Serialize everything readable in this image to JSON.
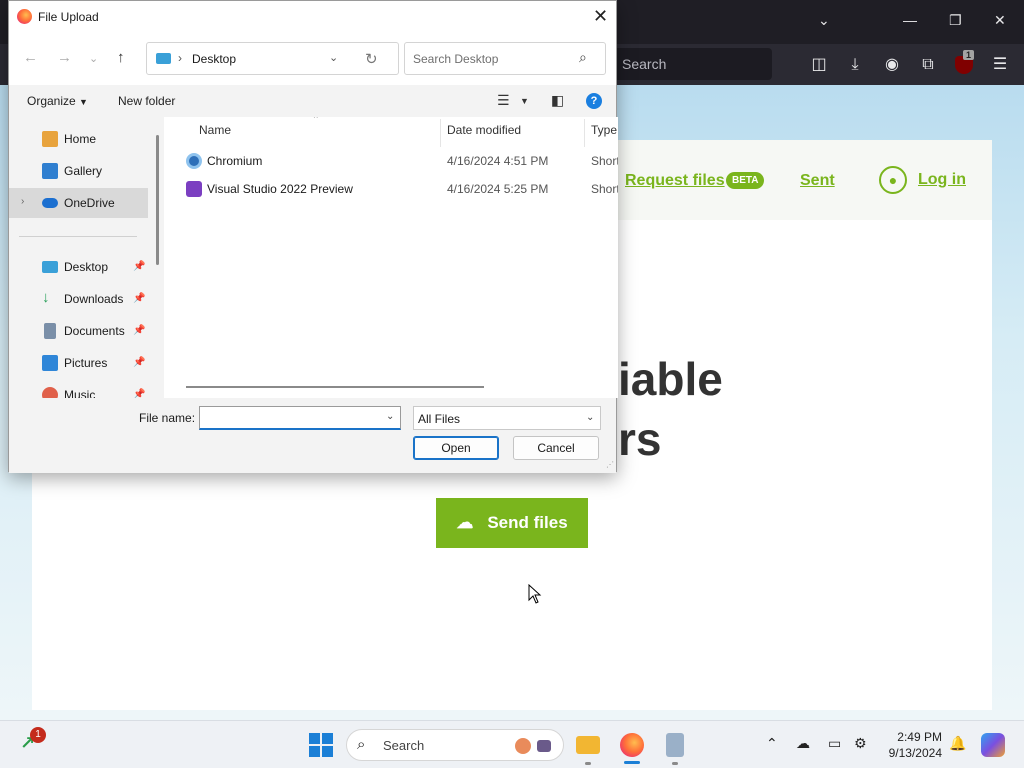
{
  "browser": {
    "search_placeholder": "Search",
    "window_controls": {
      "chevron": "⌄",
      "minimize": "—",
      "restore": "❐",
      "close": "✕"
    },
    "toolbar_icons": [
      "pocket-icon",
      "download-icon",
      "account-icon",
      "extensions-icon",
      "ublock-icon",
      "menu-icon"
    ],
    "ublock_badge": "1"
  },
  "webpage": {
    "request_files": "Request files",
    "beta": "BETA",
    "sent": "Sent",
    "login": "Log in",
    "hero_line1": "iable",
    "hero_line2": "rs",
    "send_files": "Send files",
    "brand_color": "#7ab51d"
  },
  "dialog": {
    "title": "File Upload",
    "address": {
      "location": "Desktop"
    },
    "search_placeholder": "Search Desktop",
    "commands": {
      "organize": "Organize",
      "new_folder": "New folder"
    },
    "sidebar": {
      "quick": [
        {
          "label": "Home",
          "icon": "home-icon"
        },
        {
          "label": "Gallery",
          "icon": "gallery-icon"
        },
        {
          "label": "OneDrive",
          "icon": "onedrive-icon",
          "selected": true
        }
      ],
      "pinned": [
        {
          "label": "Desktop",
          "icon": "desktop-folder-icon"
        },
        {
          "label": "Downloads",
          "icon": "downloads-folder-icon"
        },
        {
          "label": "Documents",
          "icon": "documents-folder-icon"
        },
        {
          "label": "Pictures",
          "icon": "pictures-folder-icon"
        },
        {
          "label": "Music",
          "icon": "music-folder-icon"
        }
      ]
    },
    "columns": {
      "name": "Name",
      "date": "Date modified",
      "type": "Type"
    },
    "files": [
      {
        "name": "Chromium",
        "date": "4/16/2024 4:51 PM",
        "type": "Shortcut",
        "icon": "chromium-icon"
      },
      {
        "name": "Visual Studio 2022 Preview",
        "date": "4/16/2024 5:25 PM",
        "type": "Shortcut",
        "icon": "visual-studio-icon"
      }
    ],
    "file_name_label": "File name:",
    "file_name_value": "",
    "file_type": "All Files",
    "open_button": "Open",
    "cancel_button": "Cancel"
  },
  "taskbar": {
    "search_text": "Search",
    "notification_count": "1",
    "time": "2:49 PM",
    "date": "9/13/2024"
  }
}
